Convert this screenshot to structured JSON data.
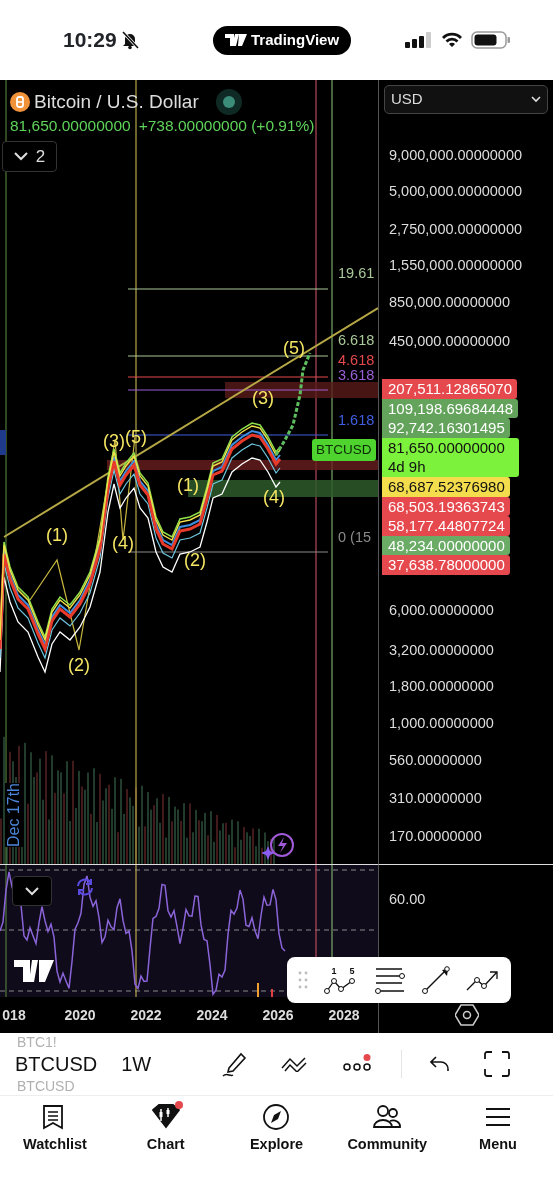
{
  "status_bar": {
    "time": "10:29",
    "app_pill": "TradingView"
  },
  "chart": {
    "symbol_title": "Bitcoin / U.S. Dollar",
    "price": "81,650.00000000",
    "change": "+738.00000000 (+0.91%)",
    "indicators_count": "2",
    "currency": "USD",
    "price_axis": [
      "9,000,000.00000000",
      "5,000,000.00000000",
      "2,750,000.00000000",
      "1,550,000.00000000",
      "850,000.00000000",
      "450,000.00000000",
      "6,000.00000000",
      "3,200.00000000",
      "1,800.00000000",
      "1,000.00000000",
      "560.00000000",
      "310.00000000",
      "170.00000000"
    ],
    "price_badges": [
      {
        "text": "207,511.12865070",
        "color": "#e5484d"
      },
      {
        "text": "109,198.69684448",
        "color": "#64a35c"
      },
      {
        "text": "92,742.16301495",
        "color": "#64a35c"
      },
      {
        "text": "81,650.00000000",
        "subtext": "4d 9h",
        "color": "#7cf23c"
      },
      {
        "text": "68,687.52376980",
        "color": "#f4dd4c"
      },
      {
        "text": "68,503.19363743",
        "color": "#e5484d"
      },
      {
        "text": "58,177.44807724",
        "color": "#e5484d"
      },
      {
        "text": "48,234.00000000",
        "color": "#6aab66"
      },
      {
        "text": "37,638.78000000",
        "color": "#e5484d"
      }
    ],
    "fib_levels": [
      {
        "label": "19.61",
        "color": "#a9c99a"
      },
      {
        "label": "6.618",
        "color": "#a9c99a"
      },
      {
        "label": "4.618",
        "color": "#e5484d"
      },
      {
        "label": "3.618",
        "color": "#9b5fd6"
      },
      {
        "label": "1.618",
        "color": "#3f5fe0"
      },
      {
        "label": "0 (15",
        "color": "#8a8a8a"
      }
    ],
    "wave_labels": [
      "(1)",
      "(2)",
      "(3)",
      "(5)",
      "(4)",
      "(1)",
      "(2)",
      "(3)",
      "(4)",
      "(5)"
    ],
    "symbol_tag": "BTCUSD",
    "date_marker": "Dec 17th",
    "rsi_axis": [
      "60.00"
    ],
    "time_axis": [
      "018",
      "2020",
      "2022",
      "2024",
      "2026",
      "2028"
    ],
    "drawing_toolbar": {
      "wave_marks": [
        "1",
        "5"
      ]
    }
  },
  "bottom_toolbar": {
    "symbol_above": "BTC1!",
    "symbol": "BTCUSD",
    "symbol_below": "BTCUSD",
    "interval": "1W",
    "more_badge": true
  },
  "tabs": [
    {
      "kind": "watchlist",
      "label": "Watchlist",
      "selected": false,
      "badge": false
    },
    {
      "kind": "chart",
      "label": "Chart",
      "selected": true,
      "badge": true
    },
    {
      "kind": "explore",
      "label": "Explore",
      "selected": false,
      "badge": false
    },
    {
      "kind": "community",
      "label": "Community",
      "selected": false,
      "badge": false
    },
    {
      "kind": "menu",
      "label": "Menu",
      "selected": false,
      "badge": false
    }
  ]
}
